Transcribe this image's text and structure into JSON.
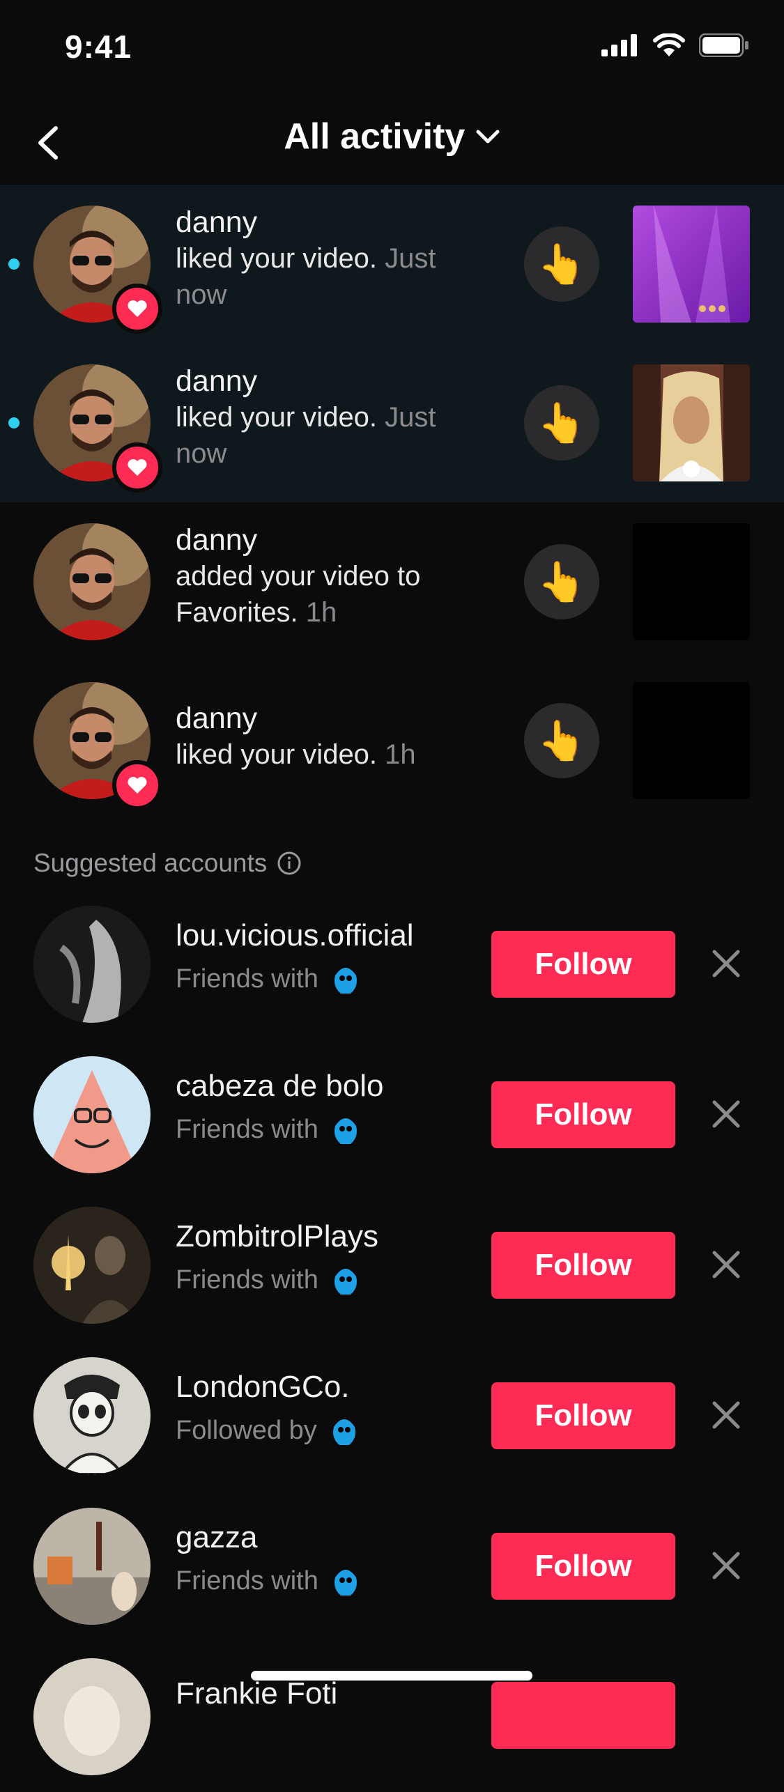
{
  "status": {
    "time": "9:41"
  },
  "header": {
    "title": "All activity"
  },
  "activities": [
    {
      "name": "danny",
      "text": "liked your video.",
      "time": "Just now",
      "unread": true,
      "badge": "heart"
    },
    {
      "name": "danny",
      "text": "liked your video.",
      "time": "Just now",
      "unread": true,
      "badge": "heart"
    },
    {
      "name": "danny",
      "text": "added your video to Favorites.",
      "time": "1h",
      "unread": false,
      "badge": "none"
    },
    {
      "name": "danny",
      "text": "liked your video.",
      "time": "1h",
      "unread": false,
      "badge": "heart"
    }
  ],
  "suggested": {
    "title": "Suggested accounts",
    "accounts": [
      {
        "name": "lou.vicious.official",
        "sub": "Friends with",
        "follow": "Follow"
      },
      {
        "name": "cabeza de bolo",
        "sub": "Friends with",
        "follow": "Follow"
      },
      {
        "name": "ZombitrolPlays",
        "sub": "Friends with",
        "follow": "Follow"
      },
      {
        "name": "LondonGCo.",
        "sub": "Followed by",
        "follow": "Follow"
      },
      {
        "name": "gazza",
        "sub": "Friends with",
        "follow": "Follow"
      },
      {
        "name": "Frankie Foti",
        "sub": "",
        "follow": ""
      }
    ]
  },
  "colors": {
    "accent": "#fe2c55",
    "unread_dot": "#2fd0f0",
    "background": "#0b0b0b"
  }
}
